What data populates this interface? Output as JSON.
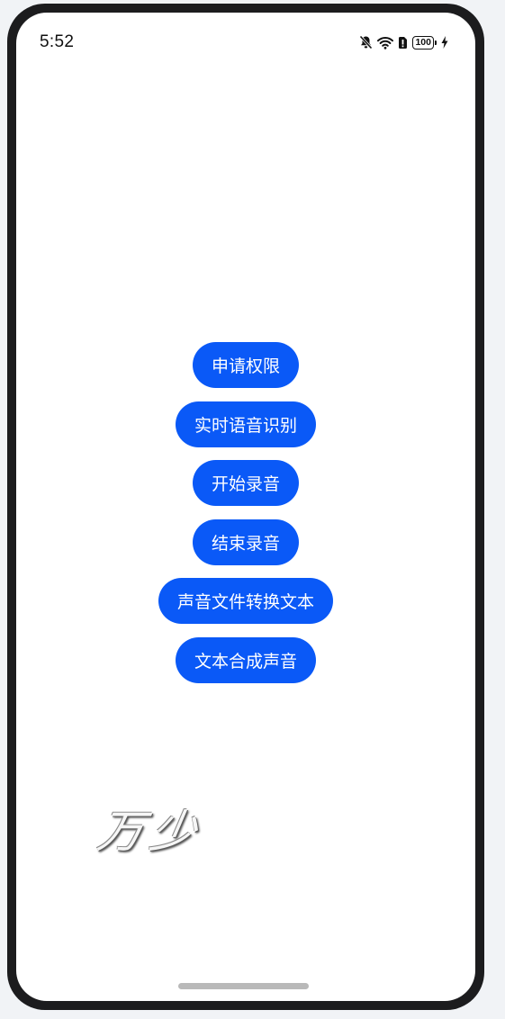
{
  "status_bar": {
    "time": "5:52",
    "battery_level": "100",
    "icons": [
      "bell-off-icon",
      "wifi-icon",
      "sim-icon",
      "battery-icon",
      "charging-icon"
    ]
  },
  "buttons": [
    {
      "label": "申请权限"
    },
    {
      "label": "实时语音识别"
    },
    {
      "label": "开始录音"
    },
    {
      "label": "结束录音"
    },
    {
      "label": "声音文件转换文本"
    },
    {
      "label": "文本合成声音"
    }
  ],
  "signature": {
    "text": "万少"
  },
  "colors": {
    "accent": "#0a59f7",
    "background": "#ffffff",
    "frame": "#1c1c1e"
  }
}
